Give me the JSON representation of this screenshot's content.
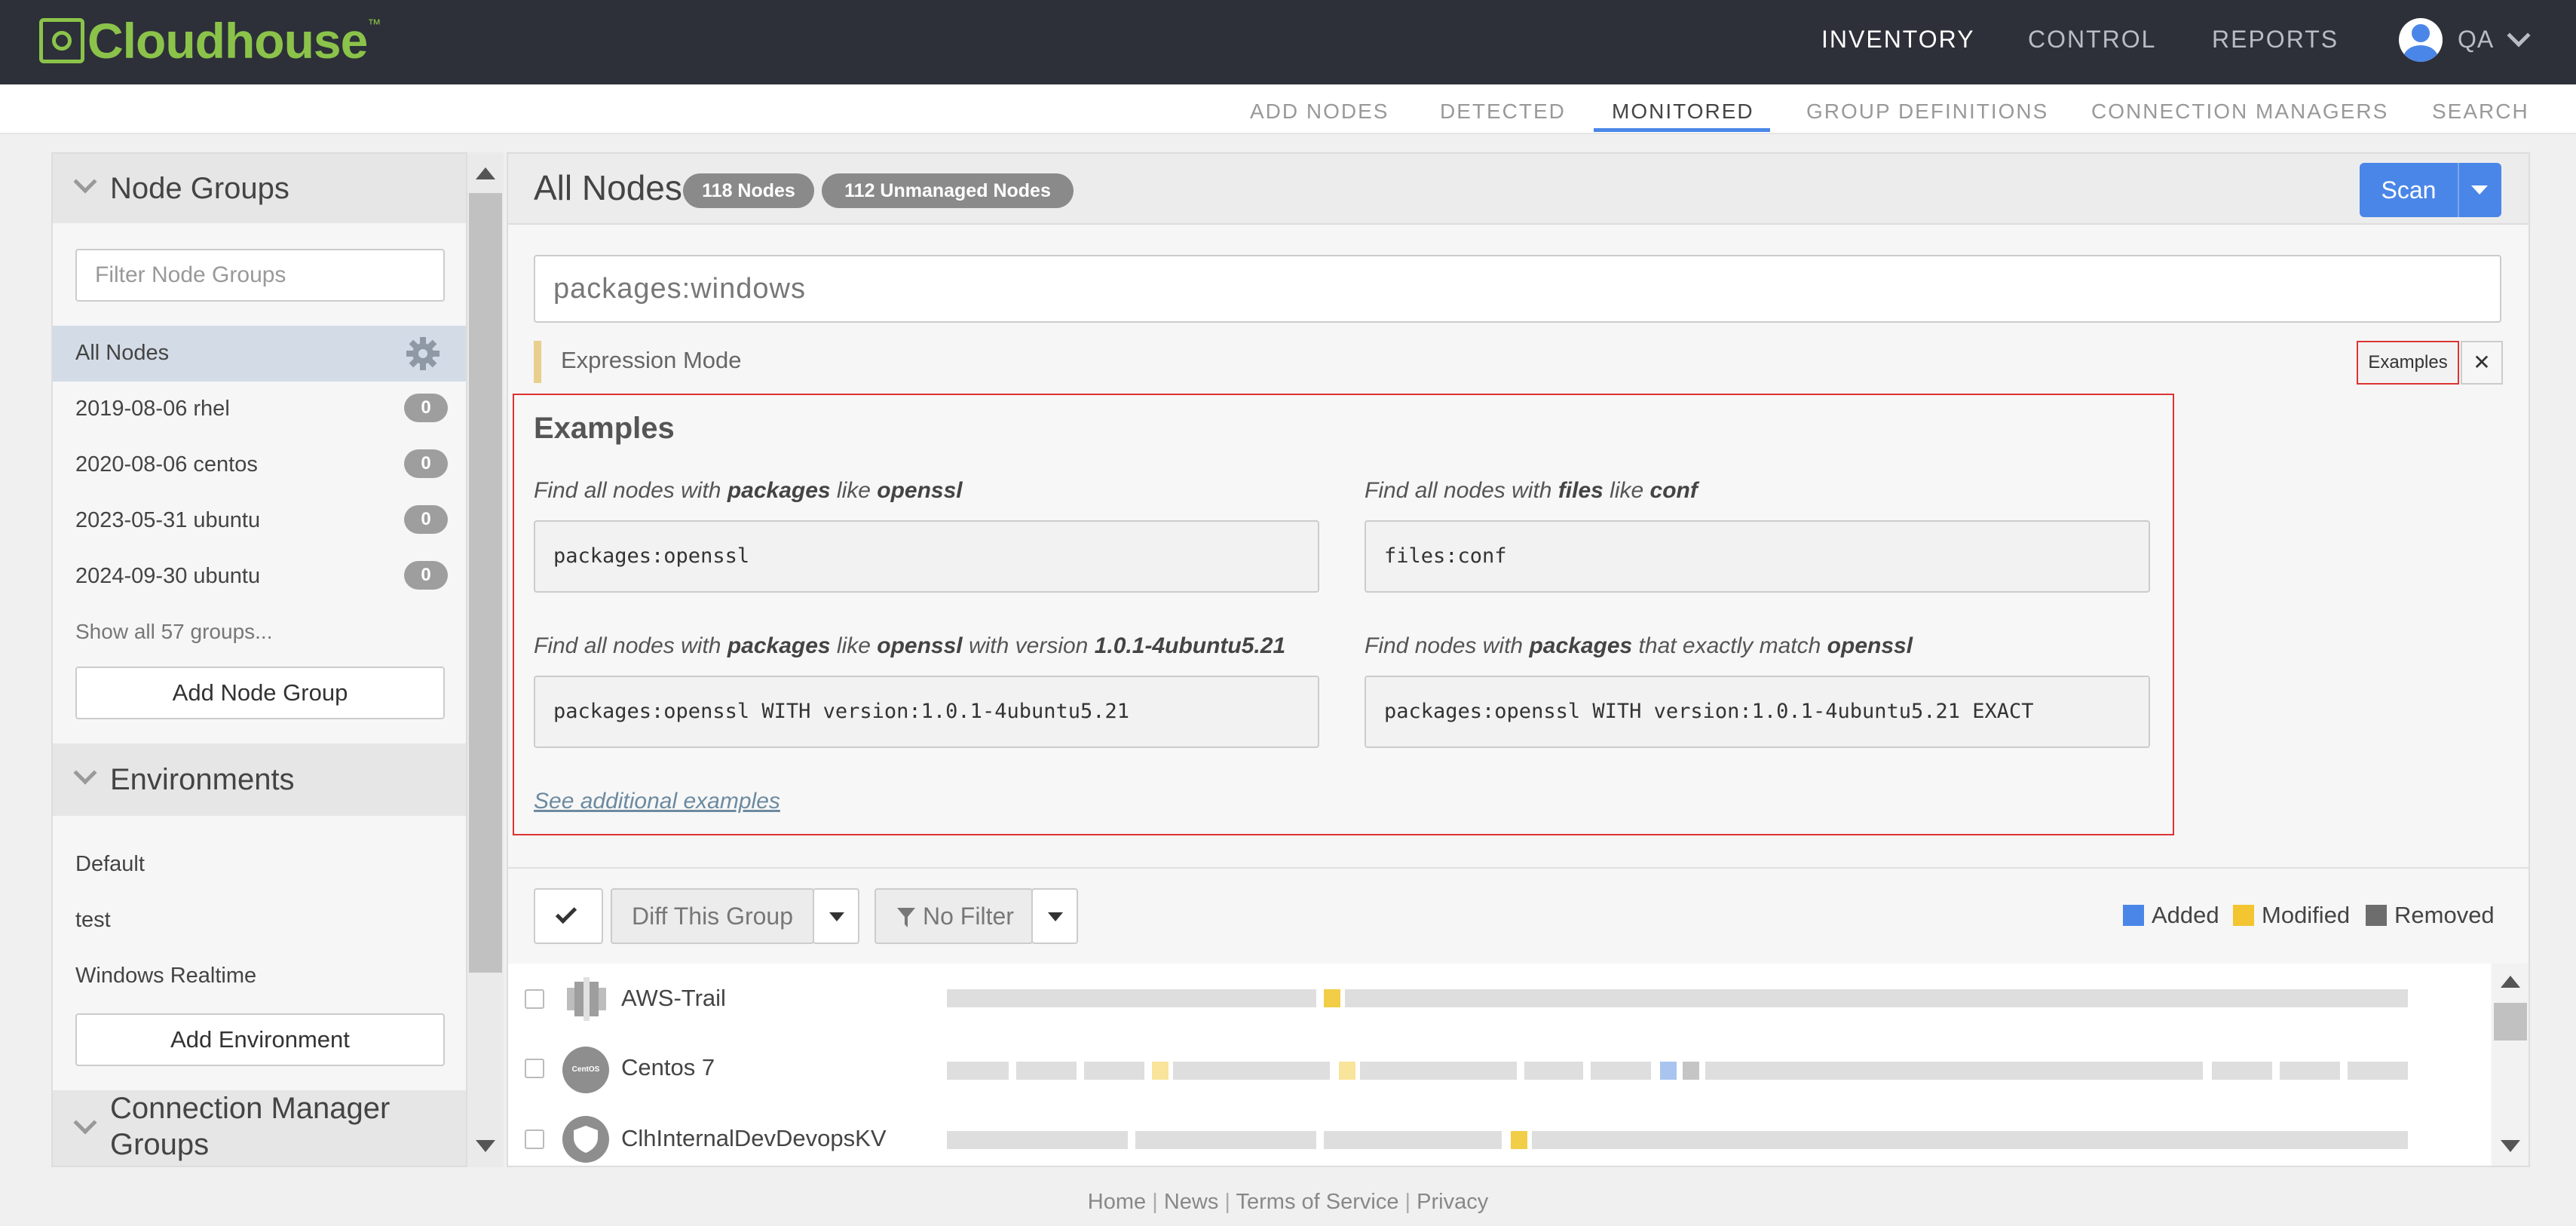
{
  "brand": {
    "name": "Cloudhouse",
    "tm": "™",
    "color": "#8bc34a"
  },
  "topnav": {
    "inventory": "INVENTORY",
    "control": "CONTROL",
    "reports": "REPORTS",
    "user": "QA"
  },
  "subnav": {
    "add_nodes": "ADD NODES",
    "detected": "DETECTED",
    "monitored": "MONITORED",
    "group_definitions": "GROUP DEFINITIONS",
    "connection_managers": "CONNECTION MANAGERS",
    "search": "SEARCH"
  },
  "sidebar": {
    "node_groups_title": "Node Groups",
    "filter_placeholder": "Filter Node Groups",
    "all_nodes": "All Nodes",
    "groups": [
      {
        "name": "2019-08-06 rhel",
        "count": "0"
      },
      {
        "name": "2020-08-06 centos",
        "count": "0"
      },
      {
        "name": "2023-05-31 ubuntu",
        "count": "0"
      },
      {
        "name": "2024-09-30 ubuntu",
        "count": "0"
      }
    ],
    "show_all": "Show all 57 groups...",
    "add_group": "Add Node Group",
    "environments_title": "Environments",
    "environments": [
      "Default",
      "test",
      "Windows Realtime"
    ],
    "add_environment": "Add Environment",
    "cm_groups_title_line1": "Connection Manager",
    "cm_groups_title_line2": "Groups"
  },
  "main": {
    "title": "All Nodes",
    "nodes_badge": "118 Nodes",
    "unmanaged_badge": "112 Unmanaged Nodes",
    "scan_label": "Scan",
    "query": "packages:windows",
    "expression_mode": "Expression Mode",
    "examples_button": "Examples",
    "close_button": "✕"
  },
  "examples": {
    "title": "Examples",
    "items": [
      {
        "pre": "Find all nodes with ",
        "k1": "packages",
        "mid": " like ",
        "k2": "openssl",
        "mid2": "",
        "k3": "",
        "code": "packages:openssl"
      },
      {
        "pre": "Find all nodes with ",
        "k1": "files",
        "mid": " like ",
        "k2": "conf",
        "mid2": "",
        "k3": "",
        "code": "files:conf"
      },
      {
        "pre": "Find all nodes with ",
        "k1": "packages",
        "mid": " like ",
        "k2": "openssl",
        "mid2": " with version ",
        "k3": "1.0.1-4ubuntu5.21",
        "code": "packages:openssl WITH version:1.0.1-4ubuntu5.21"
      },
      {
        "pre": "Find nodes with ",
        "k1": "packages",
        "mid": " that exactly match ",
        "k2": "openssl",
        "mid2": "",
        "k3": "",
        "code": "packages:openssl WITH version:1.0.1-4ubuntu5.21 EXACT"
      }
    ],
    "see_more": "See additional examples"
  },
  "toolbar": {
    "diff_label": "Diff This Group",
    "filter_label": "No Filter",
    "legend": [
      {
        "label": "Added",
        "color": "#4a86e8"
      },
      {
        "label": "Modified",
        "color": "#f2c531"
      },
      {
        "label": "Removed",
        "color": "#6d6d6d"
      }
    ]
  },
  "nodes": [
    {
      "name": "AWS-Trail",
      "icon": "aws-icon"
    },
    {
      "name": "Centos 7",
      "icon": "centos-icon",
      "icon_text": "CentOS"
    },
    {
      "name": "ClhInternalDevDevopsKV",
      "icon": "shield-icon"
    }
  ],
  "footer": {
    "home": "Home",
    "news": "News",
    "terms": "Terms of Service",
    "privacy": "Privacy",
    "sep": "|"
  }
}
